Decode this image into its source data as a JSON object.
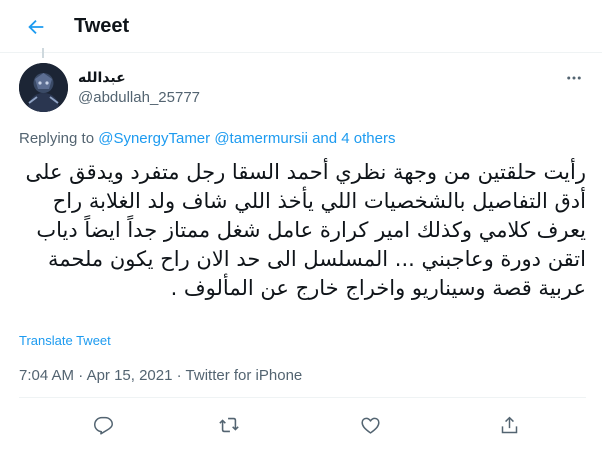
{
  "header": {
    "title": "Tweet",
    "back_icon": "arrow-left-icon",
    "accent": "#1d9bf0"
  },
  "author": {
    "display_name": "عبدالله",
    "handle": "@abdullah_25777",
    "avatar_icon": "avatar-image"
  },
  "reply": {
    "prefix": "Replying to",
    "mentions": [
      "@SynergyTamer",
      "@tamermursii"
    ],
    "and_word": "and",
    "others": "4 others"
  },
  "tweet": {
    "text": "رأيت حلقتين من وجهة نظري أحمد السقا رجل متفرد ويدقق على أدق التفاصيل بالشخصيات اللي يأخذ اللي شاف ولد الغلابة راح يعرف كلامي وكذلك امير كرارة عامل شغل ممتاز جداً ايضاً دياب اتقن دورة وعاجبني ... المسلسل الى حد الان راح يكون ملحمة عربية قصة وسيناريو واخراج خارج عن المألوف .",
    "translate_label": "Translate Tweet"
  },
  "meta": {
    "time": "7:04 AM",
    "sep1": "·",
    "date": "Apr 15, 2021",
    "sep2": "·",
    "source": "Twitter for iPhone"
  },
  "actions": {
    "reply_icon": "reply-icon",
    "retweet_icon": "retweet-icon",
    "like_icon": "heart-icon",
    "share_icon": "share-icon",
    "icon_color": "#536471"
  }
}
